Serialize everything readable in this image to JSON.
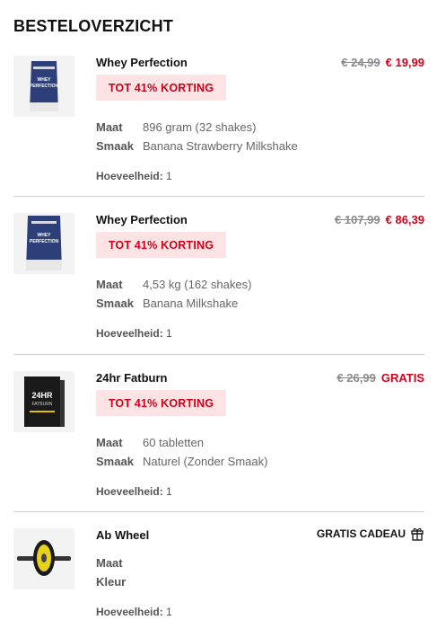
{
  "page": {
    "title": "BESTELOVERZICHT"
  },
  "items": [
    {
      "name": "Whey Perfection",
      "image": "whey-perfection-small-bag",
      "old_price": "€ 24,99",
      "new_price": "€ 19,99",
      "badge": "TOT 41% KORTING",
      "attr1_label": "Maat",
      "attr1_value": "896 gram (32 shakes)",
      "attr2_label": "Smaak",
      "attr2_value": "Banana Strawberry Milkshake",
      "qty_label": "Hoeveelheid:",
      "qty_value": "1"
    },
    {
      "name": "Whey Perfection",
      "image": "whey-perfection-large-bag",
      "old_price": "€ 107,99",
      "new_price": "€ 86,39",
      "badge": "TOT 41% KORTING",
      "attr1_label": "Maat",
      "attr1_value": "4,53 kg (162 shakes)",
      "attr2_label": "Smaak",
      "attr2_value": "Banana Milkshake",
      "qty_label": "Hoeveelheid:",
      "qty_value": "1"
    },
    {
      "name": "24hr Fatburn",
      "image": "fatburn-box",
      "old_price": "€ 26,99",
      "new_price": "GRATIS",
      "badge": "TOT 41% KORTING",
      "attr1_label": "Maat",
      "attr1_value": "60 tabletten",
      "attr2_label": "Smaak",
      "attr2_value": "Naturel (Zonder Smaak)",
      "qty_label": "Hoeveelheid:",
      "qty_value": "1"
    },
    {
      "name": "Ab Wheel",
      "image": "ab-wheel",
      "gift_label": "GRATIS CADEAU",
      "gift_icon": "gift-icon",
      "attr1_label": "Maat",
      "attr2_label": "Kleur",
      "qty_label": "Hoeveelheid:",
      "qty_value": "1"
    }
  ],
  "colors": {
    "accent_red": "#d0021b",
    "badge_bg": "#fde3e3",
    "divider": "#cfcfcf"
  }
}
